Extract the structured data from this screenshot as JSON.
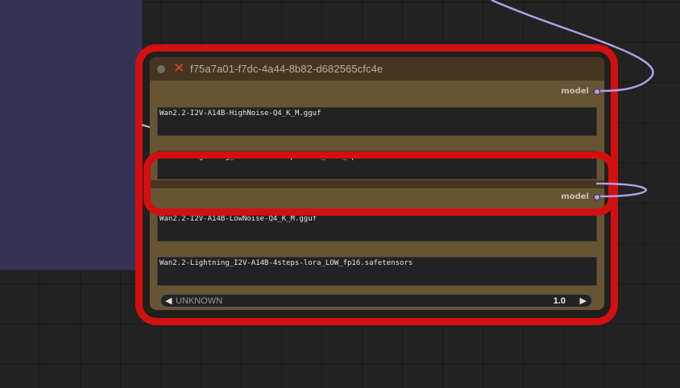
{
  "node": {
    "title": "f75a7a01-f7dc-4a44-8b82-d682565cfc4e",
    "output_label": "model",
    "high": {
      "output_label": "model",
      "model_file": "Wan2.2-I2V-A14B-HighNoise-Q4_K_M.gguf",
      "lora_file": "Wan2.2-Lightning_I2V-A14B-4steps-lora_HIGH_fp16.safetensors"
    },
    "low": {
      "output_label": "model",
      "model_file": "Wan2.2-I2V-A14B-LowNoise-Q4_K_M.gguf",
      "lora_file": "Wan2.2-Lightning_I2V-A14B-4steps-lora_LOW_fp16.safetensors"
    },
    "widget": {
      "label": "UNKNOWN",
      "value": "1.0",
      "left_icon": "triangle-left-icon",
      "right_icon": "triangle-right-icon"
    }
  },
  "colors": {
    "canvas": "#222222",
    "group": "#353256",
    "highlight": "#d30f0f",
    "node_body": "#665433",
    "node_title": "#463621",
    "link": "#b19ee6"
  }
}
